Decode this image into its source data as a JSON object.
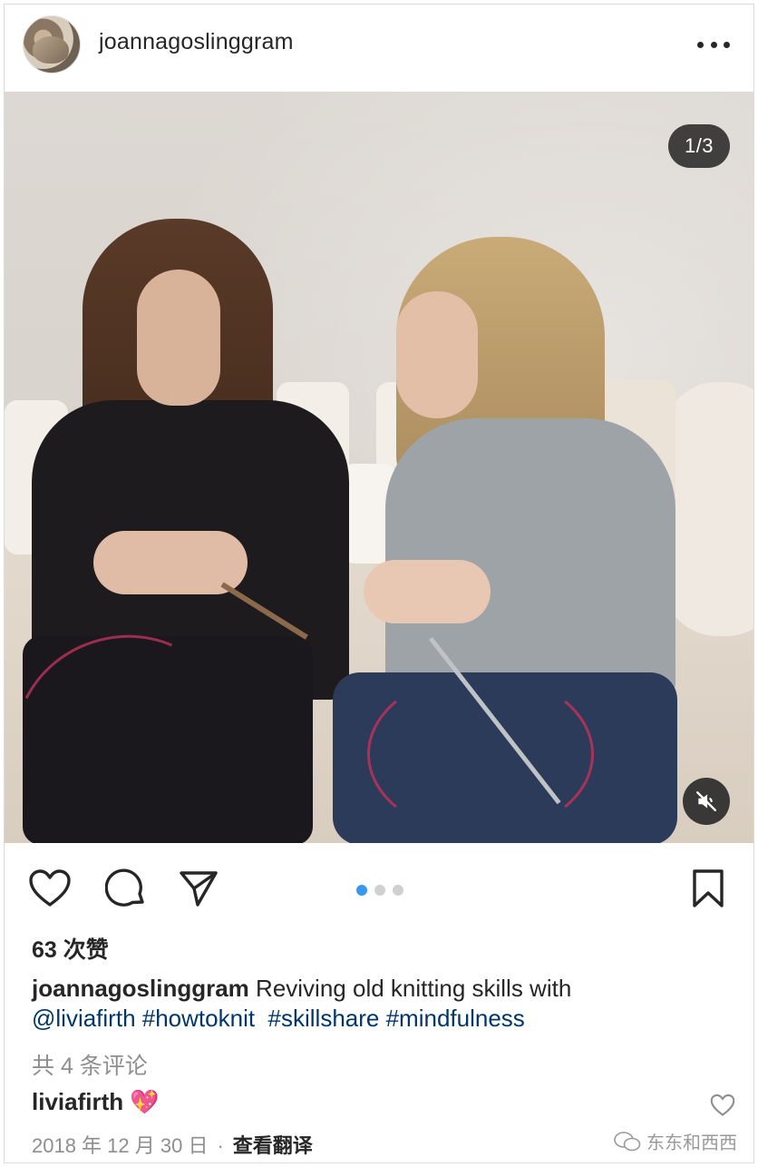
{
  "post": {
    "username": "joannagoslinggram",
    "media_counter": "1/3",
    "carousel": {
      "total": 3,
      "active_index": 0
    },
    "likes": "63 次赞",
    "caption": {
      "user": "joannagoslinggram",
      "text": "Reviving old knitting skills with",
      "mention": "@liviafirth",
      "tags": [
        "#howtoknit",
        "#skillshare",
        "#mindfulness"
      ]
    },
    "view_comments": "共 4 条评论",
    "comment": {
      "user": "liviafirth",
      "text": "💖"
    },
    "date": "2018 年 12 月 30 日",
    "separator": "·",
    "translate": "查看翻译"
  },
  "watermark": "东东和西西",
  "colors": {
    "link": "#00376b",
    "accent_dot": "#3897f0",
    "muted": "#8e8e8e"
  }
}
